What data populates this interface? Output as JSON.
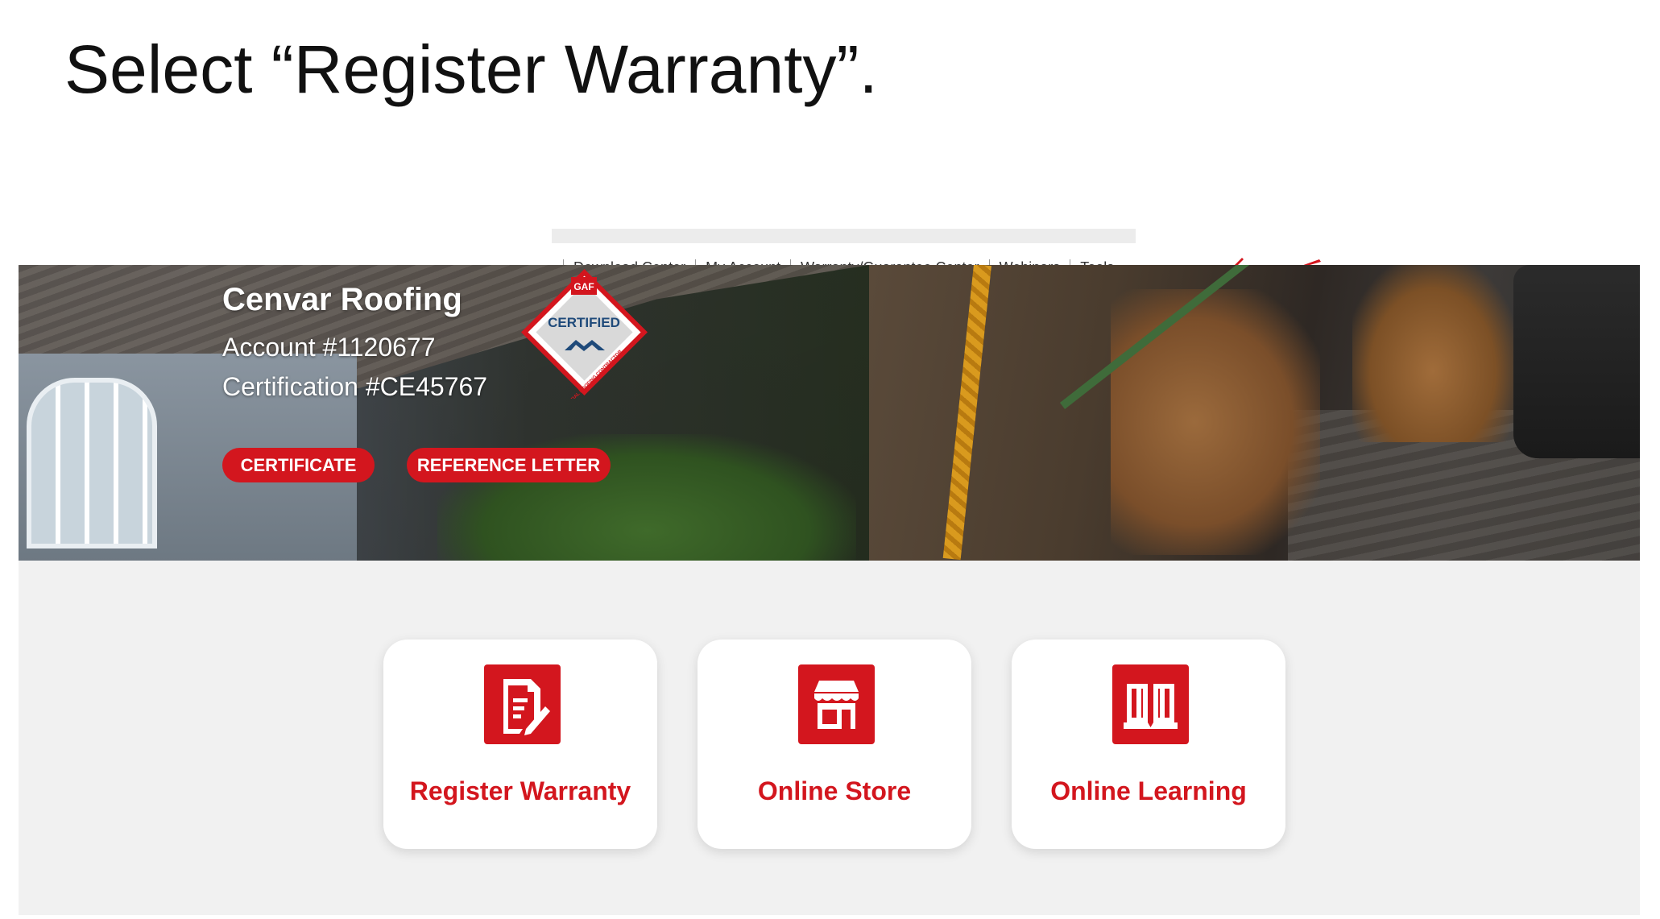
{
  "slide": {
    "title": "Select “Register Warranty”."
  },
  "top_nav": {
    "items": [
      "Download Center",
      "My Account",
      "Warranty/Guarantee Center",
      "Webinars",
      "Tools"
    ]
  },
  "hero": {
    "company_name": "Cenvar Roofing",
    "account": "Account #1120677",
    "certification": "Certification #CE45767",
    "badge": {
      "brand": "GAF",
      "label": "CERTIFIED",
      "ring_text": "RESIDENTIAL ROOFING CONTRACTOR"
    },
    "buttons": {
      "certificate": "CERTIFICATE",
      "reference_letter": "REFERENCE LETTER"
    }
  },
  "cards": [
    {
      "label": "Register Warranty",
      "icon": "document-edit-icon"
    },
    {
      "label": "Online Store",
      "icon": "storefront-icon"
    },
    {
      "label": "Online Learning",
      "icon": "book-icon"
    }
  ],
  "colors": {
    "accent": "#d3161e",
    "panel_bg": "#f1f1f1",
    "card_bg": "#ffffff",
    "text": "#111111"
  }
}
